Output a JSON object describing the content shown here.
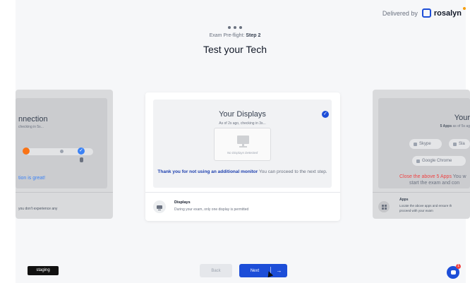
{
  "header": {
    "delivered_by": "Delivered by",
    "brand_name": "rosalyn",
    "step_prefix": "Exam Pre-flight:",
    "step_label": "Step 2",
    "title": "Test your Tech"
  },
  "left_card": {
    "title": "nnection",
    "subtitle": "checking in 5s...",
    "message": "tion is great!",
    "footer_text": "you don't experience any"
  },
  "center_card": {
    "title": "Your Displays",
    "subtitle": "As of 2s ago, checking in 3s...",
    "no_displays": "No Displays Detected",
    "message_bold": "Thank you for not using an additional monitor",
    "message_rest": " You can proceed to the next step.",
    "row_title": "Displays",
    "row_desc": "During your exam, only one display is permitted"
  },
  "right_card": {
    "title": "Your",
    "subtitle_bold": "5 Apps",
    "subtitle_rest": " as of 5s ag",
    "apps": [
      "Skype",
      "Sla",
      "Google Chrome"
    ],
    "warning_red": "Close the above 5 Apps",
    "warning_rest": " You w",
    "warning_line2": "start the exam and con",
    "apps_title": "Apps",
    "apps_desc_1": "Locate the above apps and ensure th",
    "apps_desc_2": "proceed with your exam"
  },
  "footer": {
    "staging": "staging",
    "back": "Back",
    "next": "Next",
    "next_arrow": "→",
    "chat_badge": "1"
  },
  "colors": {
    "primary": "#1d4ed8",
    "warning": "#ef4444",
    "success_link": "#3b82f6"
  }
}
